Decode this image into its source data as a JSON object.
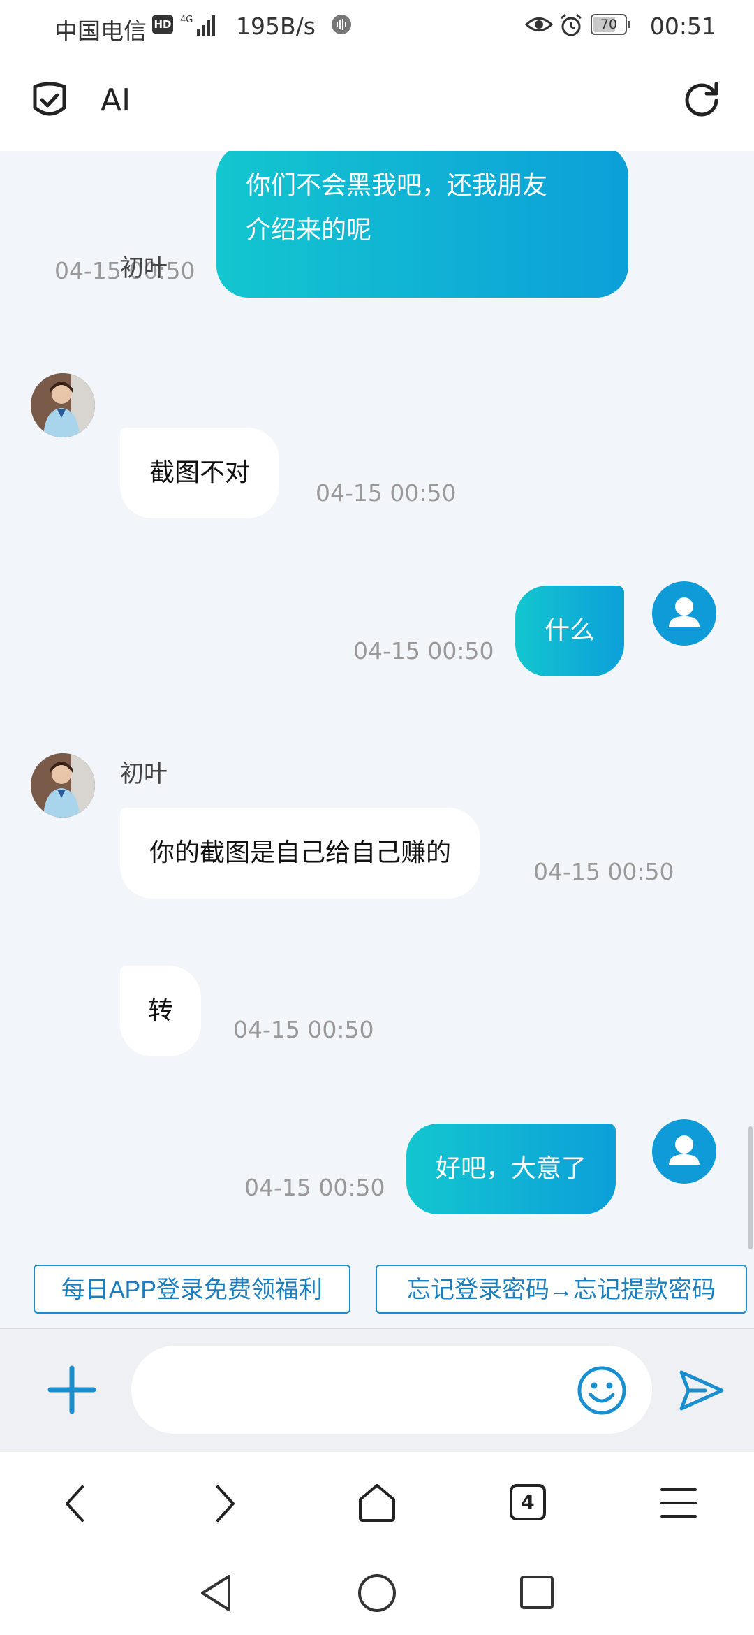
{
  "status_bar": {
    "carrier": "中国电信",
    "hd": "HD",
    "network": "4G",
    "speed": "195B/s",
    "battery": "70",
    "battery_level": 0.7,
    "time": "00:51"
  },
  "header": {
    "title": "AI"
  },
  "messages": [
    {
      "side": "out",
      "lines": [
        "你们不会黑我吧，还我朋友",
        "介绍来的呢"
      ],
      "time": "04-15 00:50"
    },
    {
      "side": "in",
      "sender": "初叶",
      "text": "截图不对",
      "time": "04-15 00:50"
    },
    {
      "side": "out",
      "text": "什么",
      "time": "04-15 00:50"
    },
    {
      "side": "in",
      "sender": "初叶",
      "text": "你的截图是自己给自己赚的",
      "time": "04-15 00:50"
    },
    {
      "side": "in",
      "text": "转",
      "time": "04-15 00:50"
    },
    {
      "side": "out",
      "text": "好吧，大意了",
      "time": "04-15 00:50"
    }
  ],
  "quick_replies": [
    "每日APP登录免费领福利",
    "忘记登录密码→忘记提款密码"
  ],
  "input": {
    "value": "",
    "placeholder": ""
  },
  "browser_nav": {
    "tab_count": "4"
  },
  "colors": {
    "accent": "#0c9fd9",
    "bubble_gradient_start": "#13c6cf",
    "bubble_gradient_end": "#0c9fd9",
    "background": "#f2f5f9"
  },
  "icons": [
    "shield-check-icon",
    "refresh-icon",
    "plus-icon",
    "emoji-icon",
    "send-icon",
    "back-icon",
    "forward-icon",
    "home-icon",
    "tabs-icon",
    "menu-icon"
  ]
}
